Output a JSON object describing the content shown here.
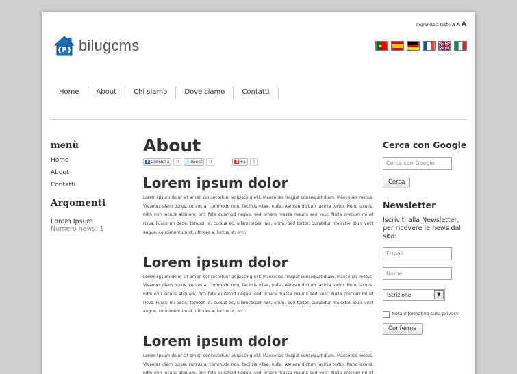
{
  "header": {
    "textsize_label": "Ingrandisci testo",
    "textsize_options": [
      "A",
      "A",
      "A"
    ],
    "logo_text": "bilugcms",
    "logo_icon_letter": "{P}"
  },
  "flags": [
    "Portugal",
    "Spain",
    "Germany",
    "France",
    "United Kingdom",
    "Italy"
  ],
  "nav": {
    "items": [
      "Home",
      "About",
      "Chi siamo",
      "Dove siamo",
      "Contatti"
    ]
  },
  "sidebar": {
    "menu_title": "menù",
    "menu_items": [
      "Home",
      "About",
      "Contatti"
    ],
    "topics_title": "Argomenti",
    "topic_name": "Lorem Ipsum",
    "topic_count": "Numero news: 1"
  },
  "main": {
    "title": "About",
    "social": {
      "fb_label": "Consiglia",
      "fb_count": "0",
      "tw_label": "Tweet",
      "tw_count": "0",
      "gp_label": "+1",
      "gp_count": "0"
    },
    "articles": [
      {
        "title": "Lorem ipsum dolor",
        "body": "Lorem ipsum dolor sit amet, consectetuer adipiscing elit. Maecenas feugiat consequat diam. Maecenas metus. Vivamus diam purus, cursus a, commodo non, facilisis vitae, nulla. Aenean dictum lacinia tortor. Nunc iaculis, nibh non iaculis aliquam, orci felis euismod neque, sed ornare massa mauris sed velit. Nulla pretium mi et risus. Fusce mi pede, tempor id, cursus ac, ullamcorper nec, enim. Sed tortor. Curabitur molestie. Duis velit augue, condimentum at, ultrices a, luctus ut, orci."
      },
      {
        "title": "Lorem ipsum dolor",
        "body": "Lorem ipsum dolor sit amet, consectetuer adipiscing elit. Maecenas feugiat consequat diam. Maecenas metus. Vivamus diam purus, cursus a, commodo non, facilisis vitae, nulla. Aenean dictum lacinia tortor. Nunc iaculis, nibh non iaculis aliquam, orci felis euismod neque, sed ornare massa mauris sed velit. Nulla pretium mi et risus. Fusce mi pede, tempor id, cursus ac, ullamcorper nec, enim. Sed tortor. Curabitur molestie. Duis velit augue, condimentum at, ultrices a, luctus ut, orci."
      },
      {
        "title": "Lorem ipsum dolor",
        "body": "Lorem ipsum dolor sit amet, consectetuer adipiscing elit. Maecenas feugiat consequat diam. Maecenas metus. Vivamus diam purus, cursus a, commodo non, facilisis vitae, nulla. Aenean dictum lacinia tortor. Nunc iaculis, nibh non iaculis aliquam, orci felis euismod neque, sed ornare massa mauris sed velit. Nulla pretium mi et risus."
      }
    ]
  },
  "search": {
    "title": "Cerca con Google",
    "placeholder": "Cerca con Google",
    "button": "Cerca"
  },
  "newsletter": {
    "title": "Newsletter",
    "description": "Iscriviti alla Newsletter, per ricevere le news dal sito:",
    "email_placeholder": "E-mail",
    "name_placeholder": "Nome",
    "select_value": "Iscrizione",
    "privacy_label": "Nota informativa sulla privacy",
    "confirm_button": "Conferma"
  },
  "colors": {
    "background": "#cfcfcf",
    "logo_blue": "#1f6fb5",
    "text": "#333333"
  }
}
